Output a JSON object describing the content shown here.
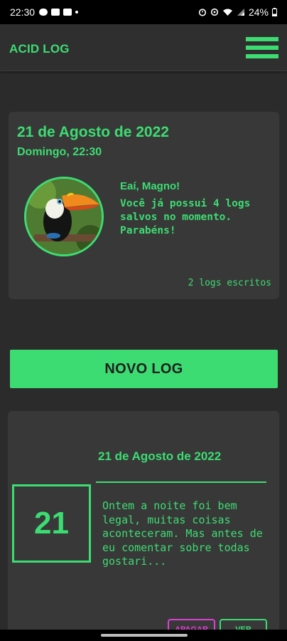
{
  "status_bar": {
    "time": "22:30",
    "battery": "24%",
    "left_icons": [
      "cloud-icon",
      "image-icon",
      "news-icon"
    ],
    "right_icons": [
      "alarm-icon",
      "sync-icon",
      "wifi-icon",
      "signal-icon",
      "battery-icon"
    ]
  },
  "app_bar": {
    "title": "ACID LOG",
    "menu_icon": "hamburger-menu-icon"
  },
  "profile_card": {
    "date": "21 de Agosto de 2022",
    "weekday_time": "Domingo, 22:30",
    "avatar_icon": "toucan-avatar",
    "greeting": "Eaí, Magno!",
    "message": "Você já possui 4 logs salvos no momento. Parabéns!",
    "log_count": "2 logs escritos"
  },
  "actions": {
    "new_log_label": "NOVO LOG"
  },
  "log_entries": [
    {
      "date": "21 de Agosto de 2022",
      "day": "21",
      "excerpt": "Ontem a noite foi bem legal, muitas coisas aconteceram. Mas antes de eu comentar sobre todas gostari...",
      "delete_label": "APAGAR",
      "view_label": "VER"
    }
  ],
  "colors": {
    "accent": "#3ddc72",
    "background": "#2b2b2b",
    "card": "#383838",
    "danger": "#e040d6"
  }
}
